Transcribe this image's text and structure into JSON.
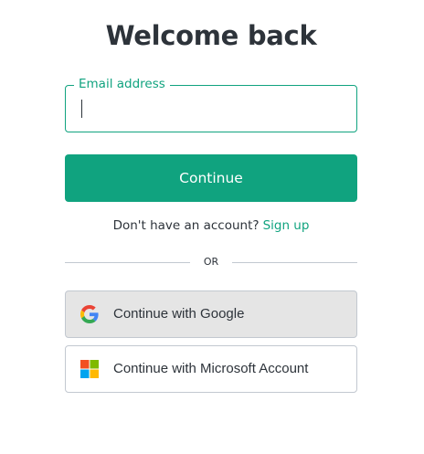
{
  "heading": "Welcome back",
  "email": {
    "label": "Email address",
    "value": ""
  },
  "continue_label": "Continue",
  "signup": {
    "prompt": "Don't have an account?",
    "link": "Sign up"
  },
  "divider_text": "OR",
  "social": {
    "google": {
      "label": "Continue with Google",
      "icon": "google-icon"
    },
    "microsoft": {
      "label": "Continue with Microsoft Account",
      "icon": "microsoft-icon"
    }
  },
  "colors": {
    "accent": "#10a37f",
    "text": "#2d333a",
    "border": "#c2c8d0",
    "google_button_bg": "#e5e5e5"
  }
}
